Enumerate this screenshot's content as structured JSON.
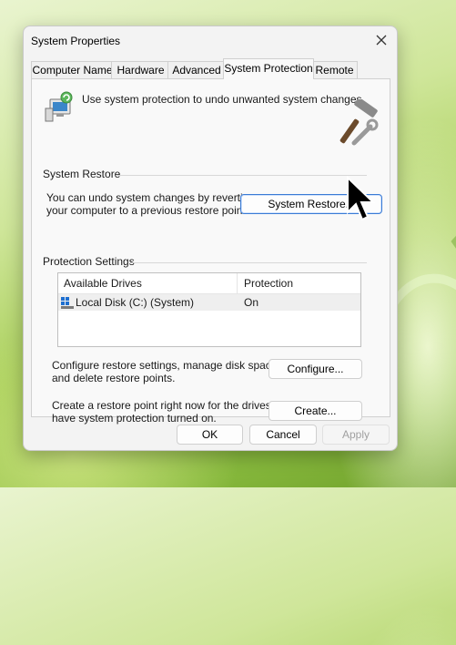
{
  "window": {
    "title": "System Properties"
  },
  "tabs": [
    {
      "label": "Computer Name",
      "active": false
    },
    {
      "label": "Hardware",
      "active": false
    },
    {
      "label": "Advanced",
      "active": false
    },
    {
      "label": "System Protection",
      "active": true
    },
    {
      "label": "Remote",
      "active": false
    }
  ],
  "intro_text": "Use system protection to undo unwanted system changes.",
  "system_restore": {
    "group_label": "System Restore",
    "description_line1": "You can undo system changes by reverting",
    "description_line2": "your computer to a previous restore point.",
    "button_label": "System Restore..."
  },
  "protection_settings": {
    "group_label": "Protection Settings",
    "columns": [
      "Available Drives",
      "Protection"
    ],
    "rows": [
      {
        "drive": "Local Disk (C:) (System)",
        "protection": "On"
      }
    ],
    "configure_text_line1": "Configure restore settings, manage disk space,",
    "configure_text_line2": "and delete restore points.",
    "configure_button": "Configure...",
    "create_text_line1": "Create a restore point right now for the drives that",
    "create_text_line2": "have system protection turned on.",
    "create_button": "Create..."
  },
  "footer": {
    "ok": "OK",
    "cancel": "Cancel",
    "apply": "Apply"
  },
  "colors": {
    "accent": "#3a7bd5",
    "window_bg": "#f3f3f3",
    "panel_bg": "#f9f9f9"
  }
}
